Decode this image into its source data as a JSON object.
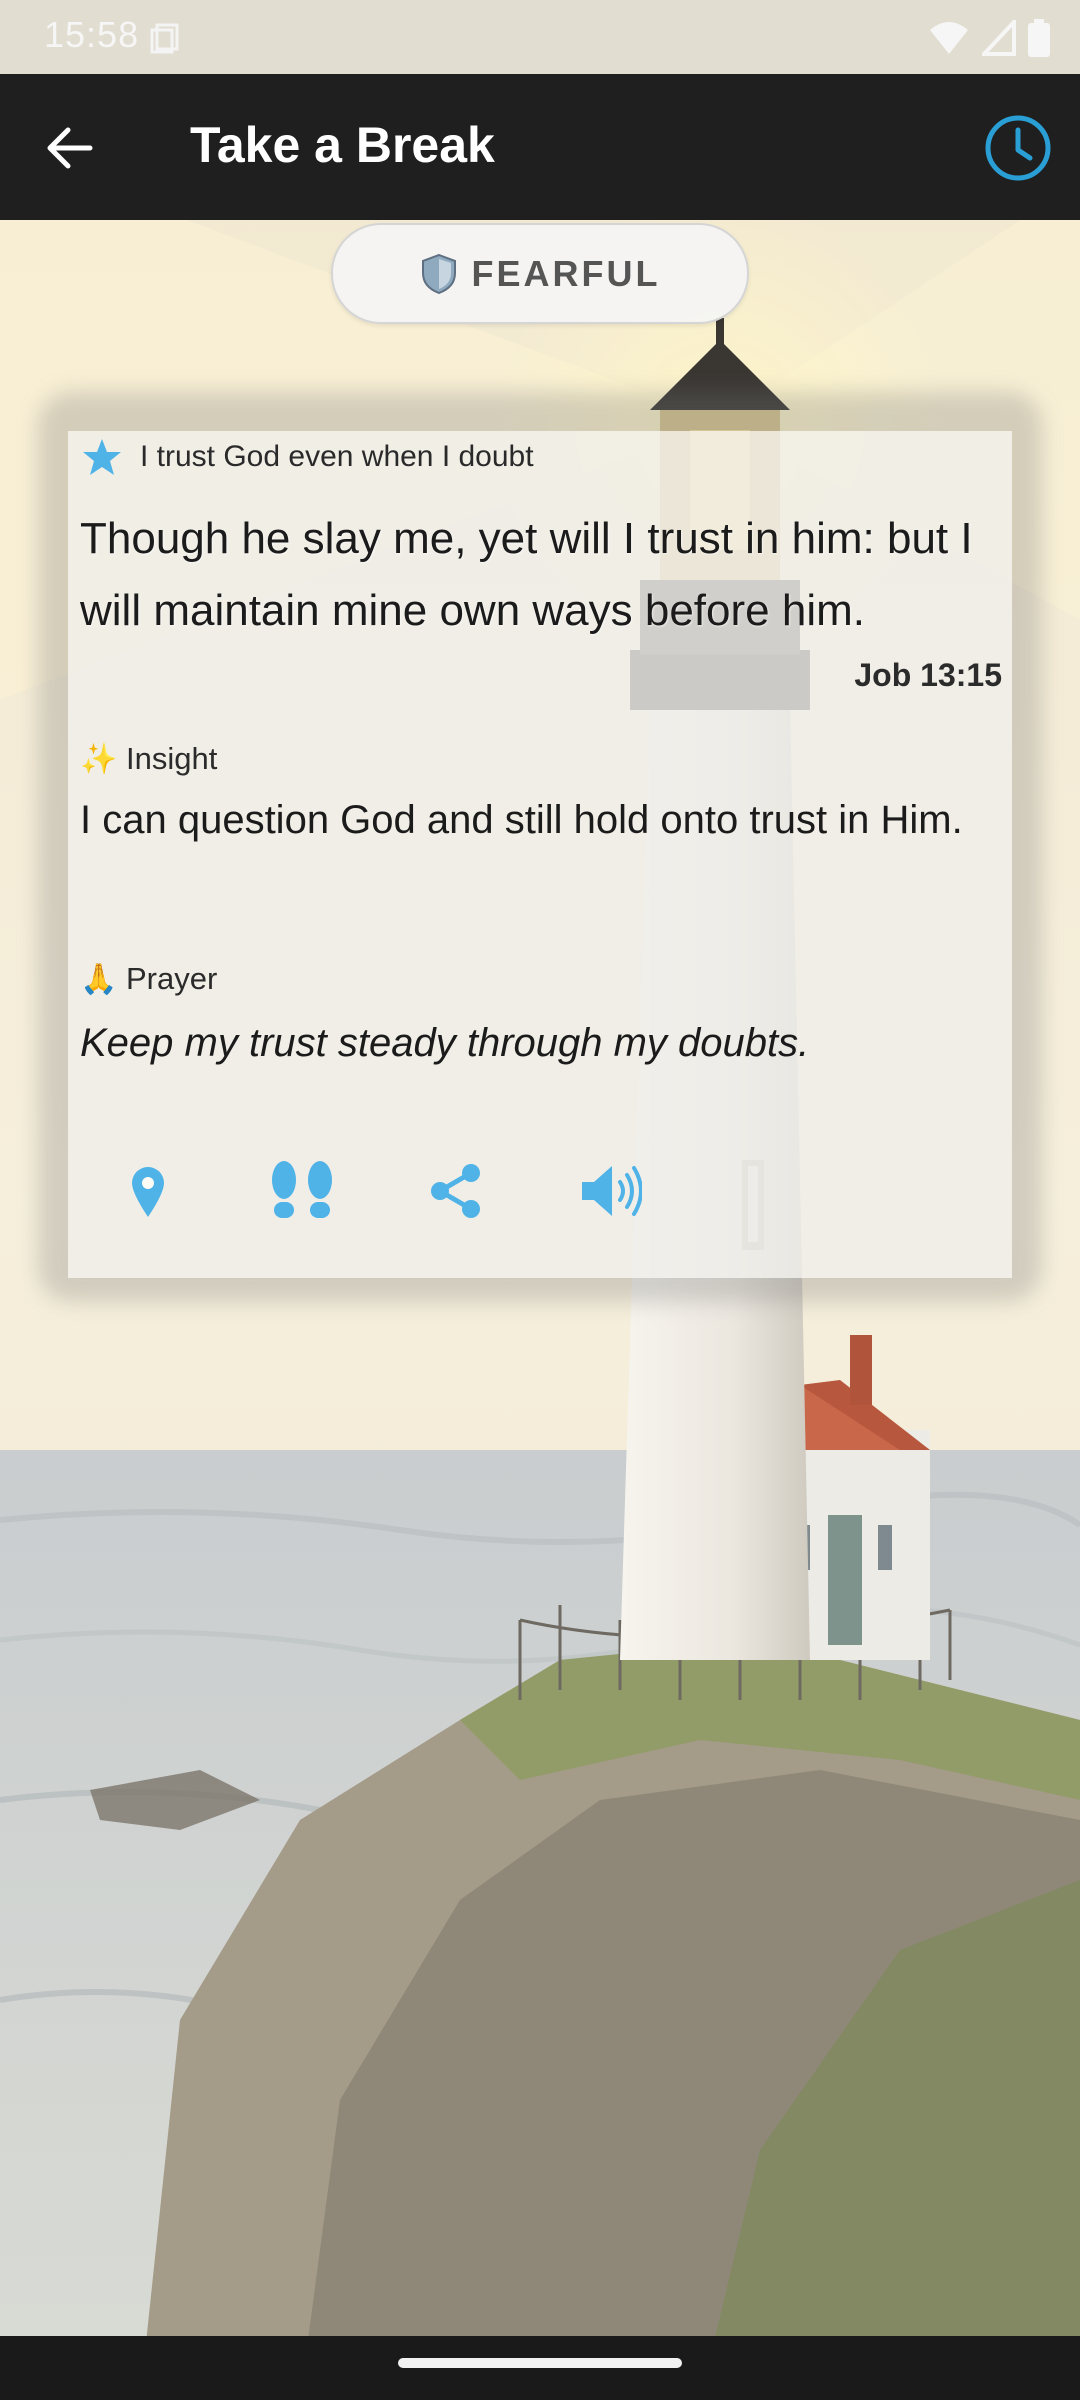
{
  "status_bar": {
    "time": "15:58"
  },
  "app_bar": {
    "title": "Take a Break"
  },
  "mood": {
    "label": "FEARFUL",
    "icon": "shield-icon"
  },
  "card": {
    "theme": "I trust God even when I doubt",
    "verse": "Though he slay me, yet will I trust in him: but I will maintain mine own ways before him.",
    "reference": "Job 13:15",
    "insight_label": "Insight",
    "insight_emoji": "✨",
    "insight": "I can question God and still hold onto trust in Him.",
    "prayer_label": "Prayer",
    "prayer_emoji": "🙏",
    "prayer": "Keep my trust steady through my doubts."
  },
  "actions": [
    {
      "icon": "location-pin-icon"
    },
    {
      "icon": "footprints-icon"
    },
    {
      "icon": "share-icon"
    },
    {
      "icon": "speaker-icon"
    }
  ],
  "colors": {
    "accent": "#4fb3e8",
    "app_bar": "#1f1f1f",
    "history_icon": "#2a9fd6"
  }
}
